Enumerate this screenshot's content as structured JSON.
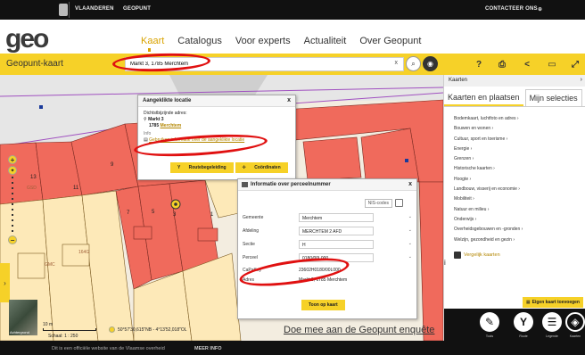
{
  "topbar": {
    "vlaanderen": "VLAANDEREN",
    "geopunt": "GEOPUNT",
    "contact": "CONTACTEER ONS"
  },
  "header": {
    "logo": "geo",
    "nav": [
      "Kaart",
      "Catalogus",
      "Voor experts",
      "Actualiteit",
      "Over Geopunt"
    ],
    "active_nav": "Kaart"
  },
  "searchbar": {
    "app_title": "Geopunt-kaart",
    "query": "Markt 3, 1785 Merchtem",
    "clear": "x"
  },
  "map": {
    "parcel_numbers": [
      "13",
      "11",
      "9",
      "7",
      "5",
      "3",
      "1"
    ],
    "selected_marker": "3",
    "building_tags": [
      "GSD",
      "164G",
      "GMC"
    ]
  },
  "popup_location": {
    "title": "Aangeklikte locatie",
    "close": "x",
    "nearest_label": "Dichtstbijzijnde adres:",
    "address_line1": "Markt 3",
    "address_line2_prefix": "1785",
    "address_line2_city": "Merchtem",
    "section_label": "Info",
    "link": "Gebruiken informatie over de aangeklikte locatie",
    "btn_route": "Routebegeleiding",
    "btn_coords": "Coördinaten"
  },
  "popup_perceel": {
    "title": "Informatie over perceelnummer",
    "close": "x",
    "nis_label": "NIS-codes",
    "rows": [
      {
        "label": "Gemeente",
        "value": "Merchtem"
      },
      {
        "label": "Afdeling",
        "value": "MERCHTEM 2 AFD"
      },
      {
        "label": "Sectie",
        "value": "H"
      },
      {
        "label": "Perceel",
        "value": "0180/00L000"
      },
      {
        "label": "CaPaKey",
        "value": "23602H0180/00L000"
      },
      {
        "label": "Adres",
        "value": "Markt 3, 1785 Merchtem"
      }
    ],
    "button": "Toon op kaart"
  },
  "panel": {
    "header": "Kaarten",
    "tabs": [
      "Kaarten en plaatsen",
      "Mijn selecties"
    ],
    "categories": [
      "Bodemkaart, luchtfoto en adres ›",
      "Bouwen en wonen ›",
      "Cultuur, sport en toerisme ›",
      "Energie ›",
      "Grenzen ›",
      "Historische kaarten ›",
      "Hoogte ›",
      "Landbouw, visserij en economie ›",
      "Mobiliteit ›",
      "Natuur en milieu ›",
      "Onderwijs ›",
      "Overheidsgebouwen en -gronden ›",
      "Welzijn, gezondheid en gezin ›"
    ],
    "vergelijk": "Vergelijk kaarten",
    "info": "i",
    "eigen_kaart": "Eigen kaart toevoegen",
    "toolbar": [
      {
        "icon": "draw-icon",
        "label": "Tools"
      },
      {
        "icon": "route-icon",
        "label": "Route"
      },
      {
        "icon": "legend-icon",
        "label": "Legende"
      },
      {
        "icon": "layers-icon",
        "label": "Kaarten"
      }
    ]
  },
  "bottom": {
    "thumb_label": "Achtergrond",
    "scale_bar": "10 m",
    "scale": "Schaal: 1 : 250",
    "coordinates": "50°57'30,615\"NB - 4°13'52,018\"OL",
    "enquete": "Doe mee aan de Geopunt enquête"
  },
  "footer": {
    "text": "Dit is een officiële website van de Vlaamse overheid",
    "meer": "MEER INFO"
  },
  "colors": {
    "brand_yellow": "#f6d128",
    "parcel_red": "#f06a5c",
    "parcel_cream": "#fde9b8",
    "highlight_red": "#e01010"
  }
}
